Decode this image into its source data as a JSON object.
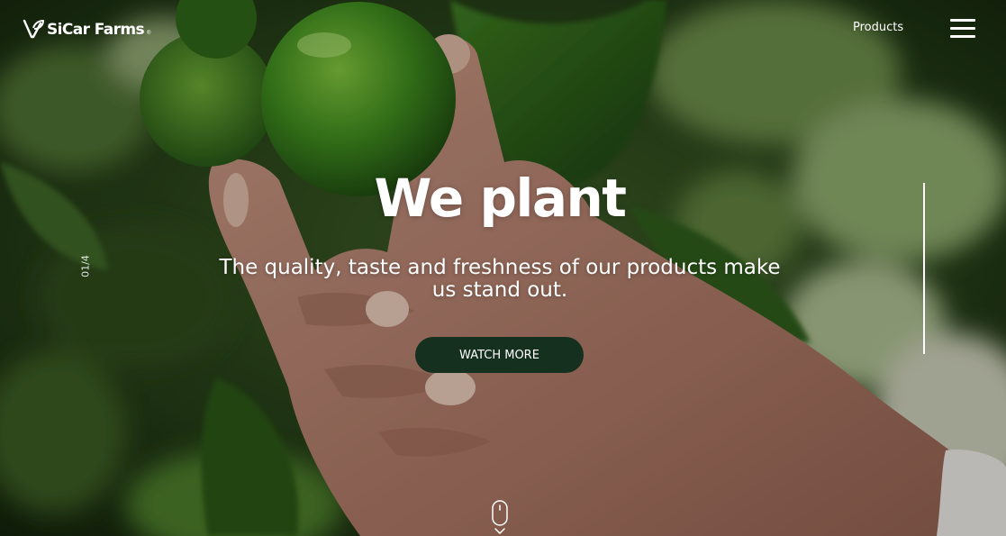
{
  "header": {
    "logo_text": "SiCar Farms",
    "logo_reg": "®",
    "nav_products": "Products",
    "menu_icon": "hamburger-menu-icon"
  },
  "hero": {
    "title": "We plant",
    "subtitle": "The quality, taste and freshness of our products make us stand out.",
    "cta_label": "WATCH MORE",
    "slide_counter": "01/4",
    "slide_progress": 1.0,
    "scroll_icon": "mouse-scroll-icon"
  },
  "colors": {
    "button_bg": "#15301e",
    "text": "#ffffff",
    "foliage_dark": "#1f2d14",
    "lime": "#4f8f27",
    "leaf": "#2d5a1b",
    "skin": "#b08470"
  }
}
